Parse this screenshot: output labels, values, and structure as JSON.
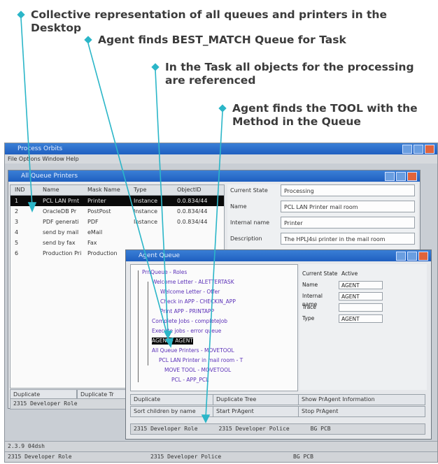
{
  "callouts": {
    "c1": "Collective representation of all queues and printers in the Desktop",
    "c2": "Agent finds BEST_MATCH Queue for Task",
    "c3": "In the Task all objects for the processing are referenced",
    "c4": "Agent finds the TOOL with the Method in the Queue"
  },
  "colors": {
    "callout_marker": "#2bb6c8",
    "arrow": "#2bb6c8",
    "callout_text": "#3b3b3b"
  },
  "main_window": {
    "title": "Process Orbits",
    "menu": "File  Options  Window  Help",
    "sub_title": "All Queue Printers",
    "table": {
      "headers": [
        "IND",
        "Name",
        "Mask Name",
        "Type",
        "ObjectID"
      ],
      "rows": [
        [
          "1",
          "PCL LAN Prnt",
          "Printer",
          "Instance",
          "0.0.834/44"
        ],
        [
          "2",
          "OracleDB Pr",
          "PostPost",
          "Instance",
          "0.0.834/44"
        ],
        [
          "3",
          "PDF generati",
          "PDF",
          "Instance",
          "0.0.834/44"
        ],
        [
          "4",
          "send by mail",
          "eMail",
          "",
          ""
        ],
        [
          "5",
          "send by fax",
          "Fax",
          "",
          ""
        ],
        [
          "6",
          "Production Pri",
          "Production",
          "",
          ""
        ]
      ]
    },
    "props": [
      {
        "label": "Current State",
        "value": "Processing"
      },
      {
        "label": "Name",
        "value": "PCL LAN Printer mail room"
      },
      {
        "label": "Internal name",
        "value": "Printer"
      },
      {
        "label": "Description",
        "value": "The HPLJ4si printer in the mail room"
      }
    ],
    "buttons": {
      "duplicate": "Duplicate",
      "duplicate_tree": "Duplicate Tr"
    },
    "status": "2315 Developer Role"
  },
  "agent_window": {
    "title": "Agent Queue",
    "tree": [
      "PrnQueue - Roles",
      "Welcome Letter - ALETTERTASK",
      "Welcome Letter - Offer",
      "Check in APP - CHECKIN_APP",
      "Print APP - PRINTAPP",
      "Complete Jobs - completeJob",
      "Execute jobs - error queue",
      "AGENT - AGENT",
      "All Queue Printers - MOVETOOL",
      "PCL LAN Printer in mail room - T",
      "MOVE TOOL - MOVETOOL",
      "PCL - APP_PCL"
    ],
    "props": [
      {
        "label": "Current State",
        "value": "Active"
      },
      {
        "label": "Name",
        "value": "AGENT"
      },
      {
        "label": "Internal name",
        "value": "AGENT"
      },
      {
        "label": "Trace",
        "value": ""
      },
      {
        "label": "Type",
        "value": "AGENT"
      }
    ],
    "buttons": [
      [
        "Duplicate",
        "Duplicate Tree",
        "Show PrAgent Information"
      ],
      [
        "Sort children by name",
        "Start PrAgent",
        "Stop PrAgent"
      ]
    ],
    "status": [
      "2315 Developer Role",
      "2315 Developer Police",
      "BG PCB"
    ]
  },
  "bottom_status": {
    "version": "2.3.9 04dsh",
    "cells": [
      "2315 Developer Role",
      "2315 Developer Police",
      "BG PCB"
    ]
  }
}
